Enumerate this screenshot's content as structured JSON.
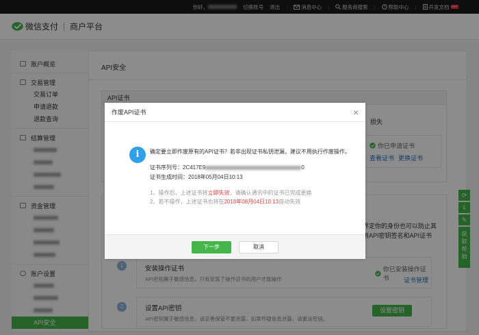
{
  "topbar": {
    "greeting": "你好，",
    "switch_account": "切换账号",
    "logout": "退出",
    "messages": "消息中心",
    "service_search": "服务商搜索",
    "help": "帮助中心",
    "dev_docs": "开发文档",
    "hot_badge": "HOT"
  },
  "header": {
    "brand": "微信支付",
    "platform": "商户平台"
  },
  "sidebar": {
    "overview": "账户概览",
    "trade_group": "交易管理",
    "trade_orders": "交易订单",
    "refund_apply": "申请退款",
    "refund_query": "退款查询",
    "settle_group": "结算管理",
    "funds_group": "资金管理",
    "account_group": "账户设置",
    "api_security": "API安全"
  },
  "page": {
    "title": "API安全",
    "cert_section": "API证书",
    "applied_cert_status": "你已申请证书",
    "view_cert": "查看证书",
    "change_cert": "更换证书",
    "partial_text_1": "损失",
    "partial_text_2": "以界定你的身份也可以防止其",
    "partial_text_3": "使用API密钥签名和API证书",
    "step1_number": "1",
    "step1_title": "安装操作证书",
    "step1_desc": "API密钥属于敏感信息，只有安装了操作证书的用户才能操作",
    "step1_status": "你已安装操作证书",
    "step1_link": "证书管理",
    "step2_number": "2",
    "step2_title": "设置API密钥",
    "step2_desc": "API密钥属于敏感信息，请妥善保管不要泄露，如果怀疑信息泄露，请重设密钥。",
    "step2_button": "设置密钥"
  },
  "modal": {
    "title": "作废API证书",
    "close": "×",
    "question": "确定要立即作废原有的API证书？若非出现证书私钥泄漏，建议不用执行作废操作。",
    "serial_label": "证书序列号：",
    "serial_value": "2C417E9",
    "serial_tail": "0",
    "generated_label": "证书生成时间：",
    "generated_value": "2018年05月04日10:13",
    "note1_pre": "1、操作后，上述证书将",
    "note1_red": "立即失效",
    "note1_post": "，请确认通讯中的证书已完成更换",
    "note2_pre": "2、若不操作，上述证书也将在",
    "note2_red": "2018年08月04日10:13",
    "note2_post": "自动失效",
    "next_button": "下一步",
    "cancel_button": "取消"
  },
  "float": {
    "help_label": "获取帮助"
  },
  "colors": {
    "accent_green": "#44b549",
    "link_blue": "#2c6fb5",
    "warn_red": "#e64340",
    "info_blue": "#30a0ea"
  }
}
